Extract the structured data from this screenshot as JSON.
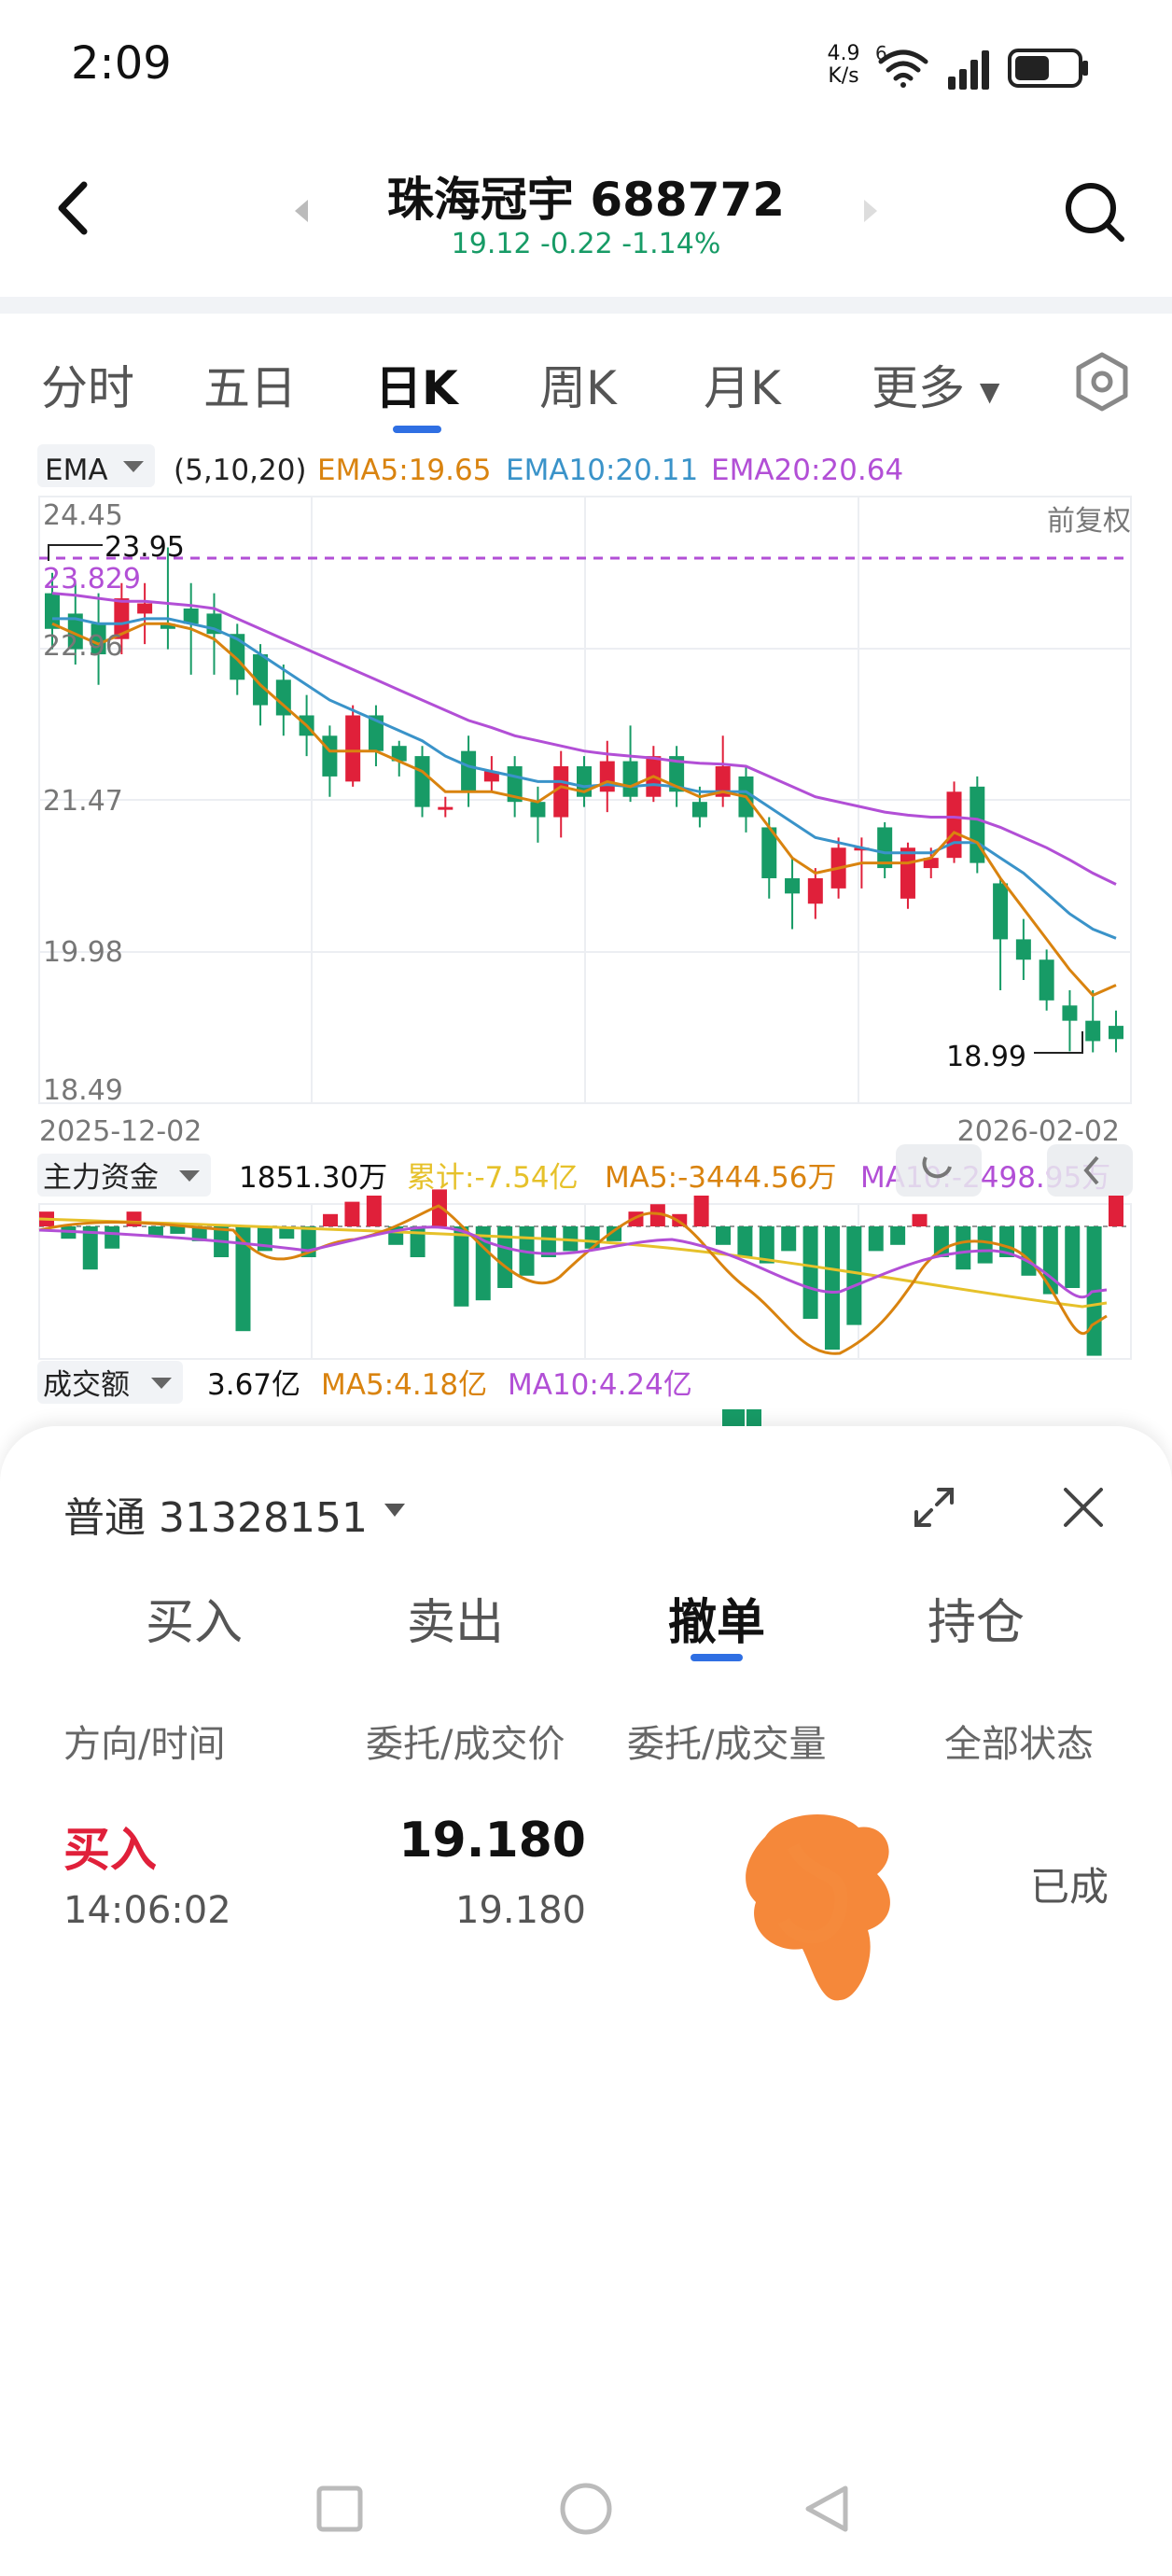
{
  "status": {
    "time": "2:09",
    "net_speed_value": "4.9",
    "net_speed_unit": "K/s",
    "network_label": "6"
  },
  "header": {
    "title": "珠海冠宇 688772",
    "quote": "19.12 -0.22 -1.14%"
  },
  "tabs": [
    {
      "label": "分时"
    },
    {
      "label": "五日"
    },
    {
      "label": "日K"
    },
    {
      "label": "周K"
    },
    {
      "label": "月K"
    },
    {
      "label": "更多"
    }
  ],
  "chart_panel": {
    "indicator_name": "EMA",
    "params": "(5,10,20)",
    "ema5_label": "EMA5:19.65",
    "ema10_label": "EMA10:20.11",
    "ema20_label": "EMA20:20.64",
    "adjust_label": "前复权",
    "start_date": "2025-12-02",
    "end_date": "2026-02-02",
    "high_label": "23.95",
    "low_label": "18.99",
    "ref_label": "23.829",
    "y_ticks": [
      "24.45",
      "22.96",
      "21.47",
      "19.98",
      "18.49"
    ],
    "fund_name": "主力资金",
    "fund_value": "1851.30万",
    "fund_total": "累计:-7.54亿",
    "fund_ma5": "MA5:-3444.56万",
    "fund_ma10": "MA10:-2498.95万",
    "amount_name": "成交额",
    "amount_value": "3.67亿",
    "amount_ma5": "MA5:4.18亿",
    "amount_ma10": "MA10:4.24亿"
  },
  "colors": {
    "up": "#e0203a",
    "down": "#179b66",
    "ema5": "#d9830f",
    "ema10": "#3a93c9",
    "ema20": "#b24fd6",
    "total": "#e6c12a",
    "accent": "#2f6fe3"
  },
  "chart_data": {
    "type": "candlestick",
    "y_range": [
      18.49,
      24.45
    ],
    "y_ticks": [
      24.45,
      22.96,
      21.47,
      19.98,
      18.49
    ],
    "candles": [
      {
        "o": 23.5,
        "c": 23.15,
        "h": 23.7,
        "l": 22.95
      },
      {
        "o": 23.3,
        "c": 22.95,
        "h": 23.6,
        "l": 22.8
      },
      {
        "o": 23.2,
        "c": 22.9,
        "h": 23.5,
        "l": 22.6
      },
      {
        "o": 23.05,
        "c": 23.45,
        "h": 23.6,
        "l": 22.9
      },
      {
        "o": 23.3,
        "c": 23.4,
        "h": 23.6,
        "l": 23.0
      },
      {
        "o": 23.2,
        "c": 23.15,
        "h": 23.95,
        "l": 22.95
      },
      {
        "o": 23.35,
        "c": 23.2,
        "h": 23.6,
        "l": 22.7
      },
      {
        "o": 23.3,
        "c": 23.1,
        "h": 23.5,
        "l": 22.7
      },
      {
        "o": 23.1,
        "c": 22.65,
        "h": 23.2,
        "l": 22.5
      },
      {
        "o": 22.9,
        "c": 22.4,
        "h": 23.0,
        "l": 22.2
      },
      {
        "o": 22.65,
        "c": 22.3,
        "h": 22.8,
        "l": 22.1
      },
      {
        "o": 22.3,
        "c": 22.1,
        "h": 22.5,
        "l": 21.9
      },
      {
        "o": 22.1,
        "c": 21.7,
        "h": 22.2,
        "l": 21.5
      },
      {
        "o": 21.65,
        "c": 22.3,
        "h": 22.4,
        "l": 21.6
      },
      {
        "o": 22.3,
        "c": 21.95,
        "h": 22.4,
        "l": 21.8
      },
      {
        "o": 22.0,
        "c": 21.85,
        "h": 22.05,
        "l": 21.7
      },
      {
        "o": 21.9,
        "c": 21.4,
        "h": 22.0,
        "l": 21.3
      },
      {
        "o": 21.4,
        "c": 21.4,
        "h": 21.5,
        "l": 21.3
      },
      {
        "o": 21.95,
        "c": 21.55,
        "h": 22.1,
        "l": 21.4
      },
      {
        "o": 21.65,
        "c": 21.75,
        "h": 21.9,
        "l": 21.55
      },
      {
        "o": 21.8,
        "c": 21.45,
        "h": 21.9,
        "l": 21.3
      },
      {
        "o": 21.45,
        "c": 21.3,
        "h": 21.6,
        "l": 21.05
      },
      {
        "o": 21.3,
        "c": 21.8,
        "h": 21.95,
        "l": 21.1
      },
      {
        "o": 21.8,
        "c": 21.5,
        "h": 21.9,
        "l": 21.4
      },
      {
        "o": 21.55,
        "c": 21.85,
        "h": 22.05,
        "l": 21.35
      },
      {
        "o": 21.85,
        "c": 21.5,
        "h": 22.2,
        "l": 21.45
      },
      {
        "o": 21.5,
        "c": 21.9,
        "h": 22.0,
        "l": 21.45
      },
      {
        "o": 21.9,
        "c": 21.55,
        "h": 22.0,
        "l": 21.4
      },
      {
        "o": 21.45,
        "c": 21.3,
        "h": 21.6,
        "l": 21.2
      },
      {
        "o": 21.5,
        "c": 21.8,
        "h": 22.1,
        "l": 21.4
      },
      {
        "o": 21.7,
        "c": 21.3,
        "h": 21.8,
        "l": 21.15
      },
      {
        "o": 21.2,
        "c": 20.7,
        "h": 21.3,
        "l": 20.5
      },
      {
        "o": 20.7,
        "c": 20.55,
        "h": 20.9,
        "l": 20.2
      },
      {
        "o": 20.45,
        "c": 20.7,
        "h": 20.8,
        "l": 20.3
      },
      {
        "o": 20.6,
        "c": 21.0,
        "h": 21.1,
        "l": 20.5
      },
      {
        "o": 21.0,
        "c": 21.0,
        "h": 21.1,
        "l": 20.6
      },
      {
        "o": 21.2,
        "c": 20.8,
        "h": 21.25,
        "l": 20.7
      },
      {
        "o": 20.5,
        "c": 21.0,
        "h": 21.05,
        "l": 20.4
      },
      {
        "o": 20.8,
        "c": 20.9,
        "h": 21.0,
        "l": 20.7
      },
      {
        "o": 20.9,
        "c": 21.55,
        "h": 21.65,
        "l": 20.85
      },
      {
        "o": 21.6,
        "c": 20.85,
        "h": 21.7,
        "l": 20.75
      },
      {
        "o": 20.65,
        "c": 20.1,
        "h": 20.7,
        "l": 19.6
      },
      {
        "o": 20.1,
        "c": 19.9,
        "h": 20.3,
        "l": 19.7
      },
      {
        "o": 19.9,
        "c": 19.5,
        "h": 20.0,
        "l": 19.4
      },
      {
        "o": 19.45,
        "c": 19.3,
        "h": 19.6,
        "l": 19.0
      },
      {
        "o": 19.3,
        "c": 19.1,
        "h": 19.6,
        "l": 18.99
      },
      {
        "o": 19.25,
        "c": 19.12,
        "h": 19.4,
        "l": 18.99
      }
    ],
    "ema5": [
      23.2,
      23.1,
      23.0,
      23.1,
      23.2,
      23.2,
      23.15,
      23.05,
      22.85,
      22.6,
      22.4,
      22.2,
      21.95,
      21.95,
      21.95,
      21.85,
      21.75,
      21.55,
      21.55,
      21.55,
      21.5,
      21.45,
      21.6,
      21.55,
      21.65,
      21.6,
      21.7,
      21.6,
      21.5,
      21.55,
      21.5,
      21.2,
      20.9,
      20.75,
      20.8,
      20.85,
      20.85,
      20.85,
      20.9,
      21.15,
      21.05,
      20.7,
      20.4,
      20.1,
      19.8,
      19.55,
      19.65
    ],
    "ema10": [
      23.25,
      23.25,
      23.2,
      23.2,
      23.25,
      23.25,
      23.2,
      23.15,
      23.05,
      22.9,
      22.75,
      22.6,
      22.45,
      22.35,
      22.25,
      22.15,
      22.05,
      21.9,
      21.8,
      21.75,
      21.7,
      21.65,
      21.65,
      21.6,
      21.62,
      21.6,
      21.62,
      21.6,
      21.55,
      21.55,
      21.55,
      21.4,
      21.25,
      21.1,
      21.05,
      21.0,
      20.95,
      20.95,
      20.95,
      21.05,
      21.05,
      20.9,
      20.75,
      20.55,
      20.35,
      20.2,
      20.11
    ],
    "ema20": [
      23.5,
      23.48,
      23.45,
      23.42,
      23.42,
      23.4,
      23.38,
      23.35,
      23.25,
      23.15,
      23.05,
      22.95,
      22.85,
      22.75,
      22.65,
      22.55,
      22.45,
      22.35,
      22.25,
      22.18,
      22.1,
      22.05,
      22.0,
      21.95,
      21.92,
      21.9,
      21.88,
      21.85,
      21.83,
      21.82,
      21.8,
      21.7,
      21.6,
      21.5,
      21.45,
      21.4,
      21.35,
      21.32,
      21.3,
      21.3,
      21.28,
      21.2,
      21.1,
      21.0,
      20.88,
      20.75,
      20.64
    ],
    "fund_flow": [
      0.12,
      -0.1,
      -0.35,
      -0.18,
      0.12,
      -0.08,
      -0.06,
      -0.12,
      -0.25,
      -0.85,
      -0.2,
      -0.1,
      -0.25,
      0.1,
      0.2,
      0.25,
      -0.15,
      -0.25,
      0.3,
      -0.65,
      -0.6,
      -0.5,
      -0.4,
      -0.25,
      -0.2,
      -0.18,
      -0.12,
      0.12,
      0.18,
      0.1,
      0.25,
      -0.15,
      -0.25,
      -0.3,
      -0.2,
      -0.75,
      -1.0,
      -0.8,
      -0.2,
      -0.15,
      0.1,
      -0.25,
      -0.35,
      -0.3,
      -0.25,
      -0.4,
      -0.55,
      -0.5,
      -1.05,
      0.25
    ]
  },
  "trade": {
    "account": "普通 31328151",
    "tabs": [
      {
        "label": "买入"
      },
      {
        "label": "卖出"
      },
      {
        "label": "撤单"
      },
      {
        "label": "持仓"
      }
    ],
    "columns": [
      "方向/时间",
      "委托/成交价",
      "委托/成交量",
      "全部状态"
    ],
    "order": {
      "direction": "买入",
      "time": "14:06:02",
      "price": "19.180",
      "deal_price": "19.180",
      "status": "已成"
    }
  }
}
